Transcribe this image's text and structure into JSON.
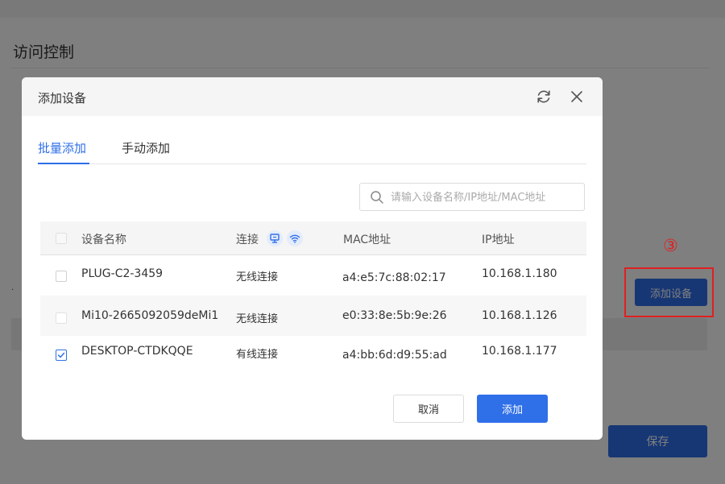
{
  "page": {
    "title": "访问控制",
    "add_device_label": "添加设备",
    "save_label": "保存",
    "dot": ".",
    "annotation_step": "③"
  },
  "modal": {
    "title": "添加设备",
    "tabs": [
      {
        "label": "批量添加",
        "active": true
      },
      {
        "label": "手动添加",
        "active": false
      }
    ],
    "search": {
      "placeholder": "请输入设备名称/IP地址/MAC地址",
      "value": ""
    },
    "table": {
      "headers": {
        "name": "设备名称",
        "connection": "连接",
        "mac": "MAC地址",
        "ip": "IP地址"
      },
      "rows": [
        {
          "checked": false,
          "name": "PLUG-C2-3459",
          "connection": "无线连接",
          "mac": "a4:e5:7c:88:02:17",
          "ip": "10.168.1.180"
        },
        {
          "checked": false,
          "name": "Mi10-2665092059deMi1",
          "connection": "无线连接",
          "mac": "e0:33:8e:5b:9e:26",
          "ip": "10.168.1.126"
        },
        {
          "checked": true,
          "name": "DESKTOP-CTDKQQE",
          "connection": "有线连接",
          "mac": "a4:bb:6d:d9:55:ad",
          "ip": "10.168.1.177"
        }
      ]
    },
    "buttons": {
      "cancel": "取消",
      "confirm": "添加"
    }
  },
  "icons": {
    "refresh": "refresh-icon",
    "close": "close-icon",
    "search": "search-icon",
    "wired": "ethernet-icon",
    "wireless": "wifi-icon",
    "check": "check-icon"
  },
  "colors": {
    "primary": "#2f6fe8",
    "annotation_red": "#e02020",
    "overlay": "rgba(0,0,0,0.5)"
  }
}
